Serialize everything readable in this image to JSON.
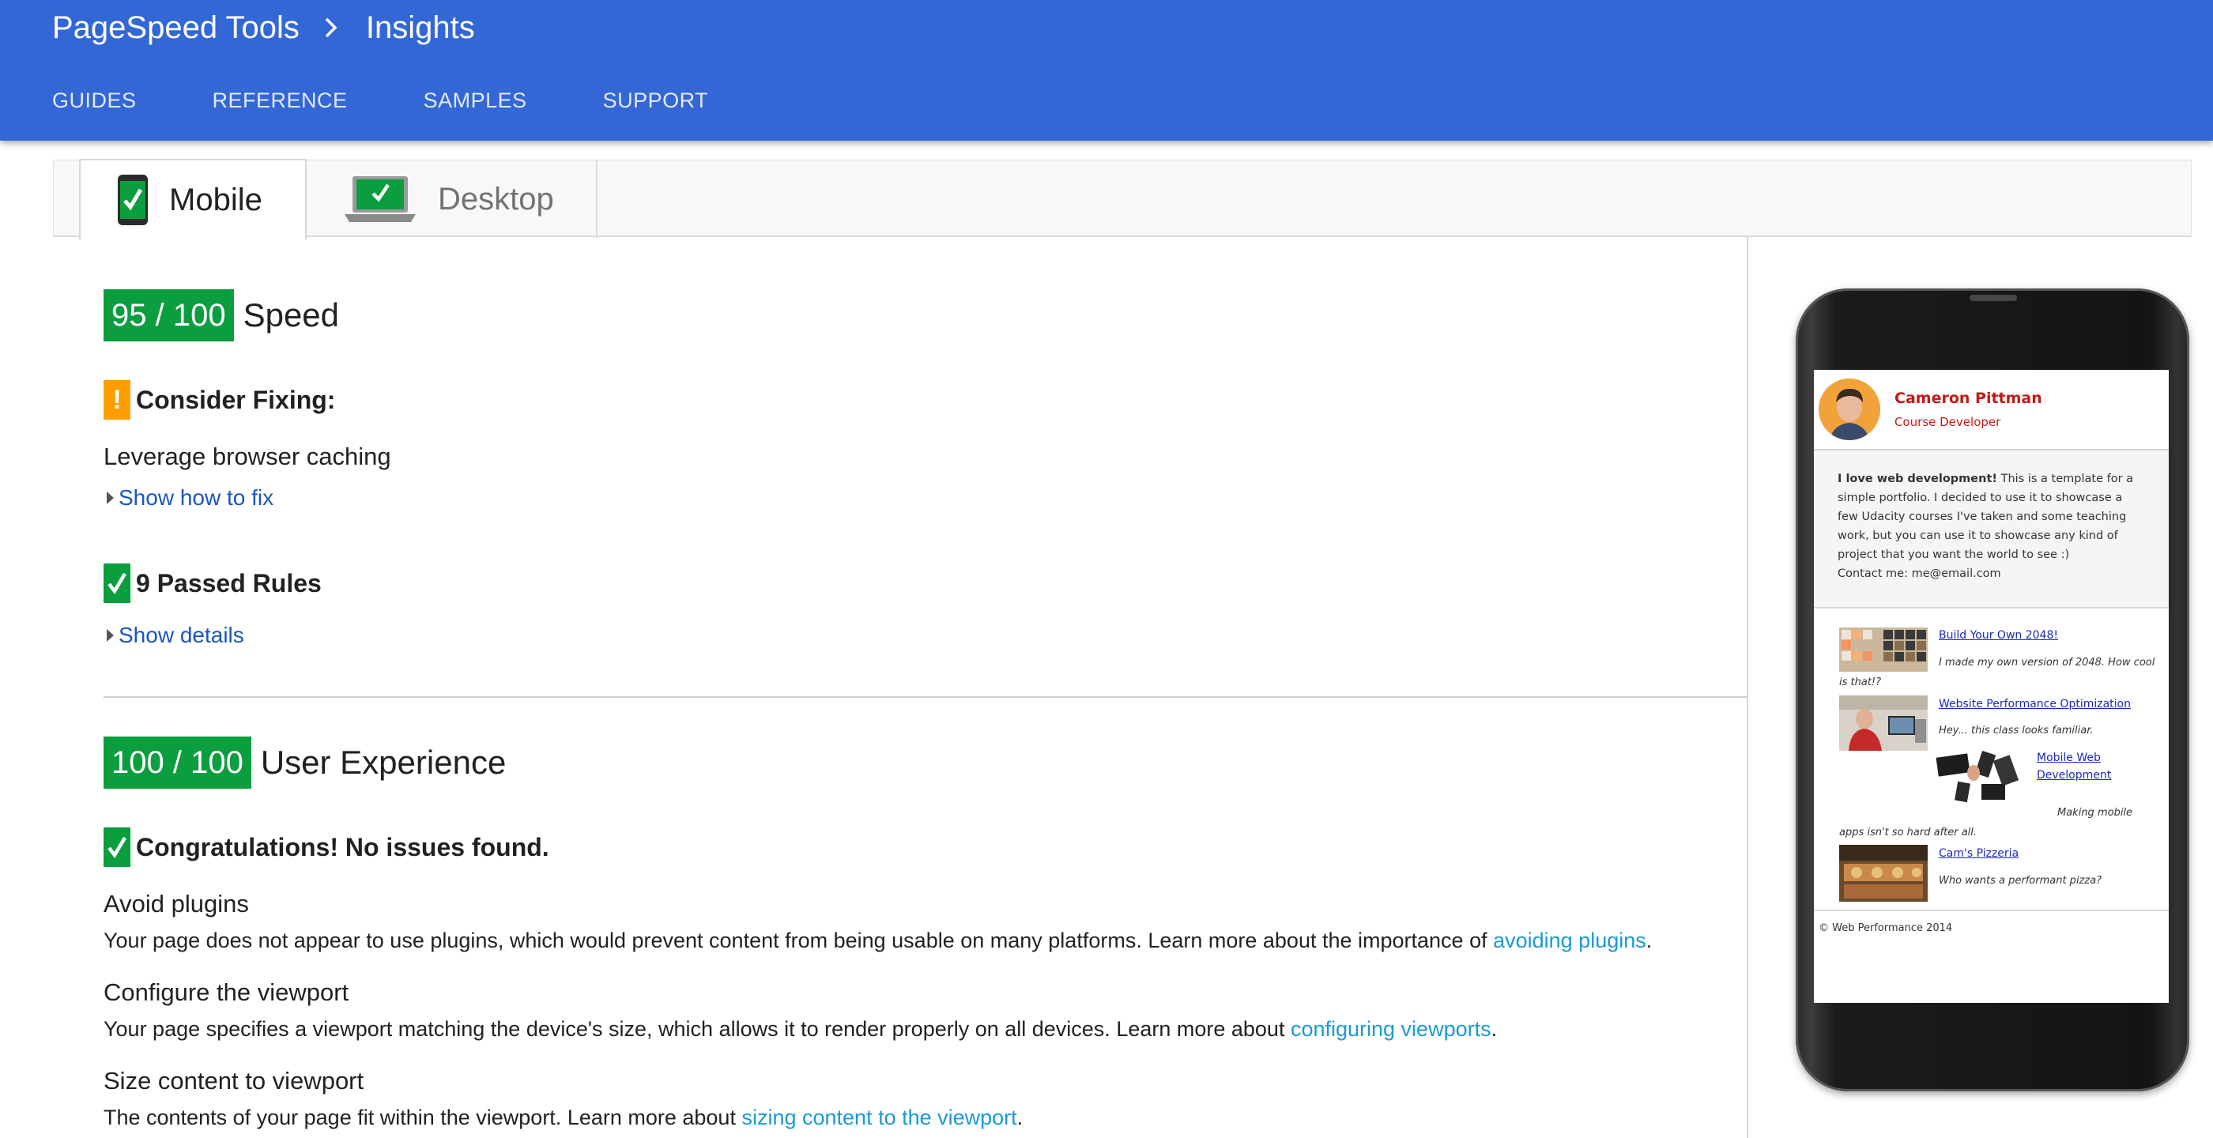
{
  "header": {
    "breadcrumb": [
      "PageSpeed Tools",
      "Insights"
    ],
    "nav": [
      "GUIDES",
      "REFERENCE",
      "SAMPLES",
      "SUPPORT"
    ],
    "background": "#3367d6"
  },
  "tabs": [
    {
      "label": "Mobile",
      "icon": "phone-check-icon",
      "selected": true
    },
    {
      "label": "Desktop",
      "icon": "laptop-check-icon",
      "selected": false
    }
  ],
  "speed": {
    "score": "95 / 100",
    "title": "Speed",
    "consider_label": "Consider Fixing:",
    "consider_item": "Leverage browser caching",
    "show_fix": "Show how to fix",
    "passed_label": "9 Passed Rules",
    "show_details": "Show details"
  },
  "ux": {
    "score": "100 / 100",
    "title": "User Experience",
    "congrats": "Congratulations! No issues found.",
    "rules": [
      {
        "title": "Avoid plugins",
        "text": "Your page does not appear to use plugins, which would prevent content from being usable on many platforms. Learn more about the importance of ",
        "link": "avoiding plugins",
        "end": "."
      },
      {
        "title": "Configure the viewport",
        "text": "Your page specifies a viewport matching the device's size, which allows it to render properly on all devices. Learn more about ",
        "link": "configuring viewports",
        "end": "."
      },
      {
        "title": "Size content to viewport",
        "text": "The contents of your page fit within the viewport. Learn more about ",
        "link": "sizing content to the viewport",
        "end": "."
      }
    ]
  },
  "preview": {
    "name": "Cameron Pittman",
    "role": "Course Developer",
    "bio_bold": "I love web development!",
    "bio_text": " This is a template for a simple portfolio. I decided to use it to showcase a few Udacity courses I've taken and some teaching work, but you can use it to showcase any kind of project that you want the world to see :)",
    "contact": "Contact me: me@email.com",
    "items": [
      {
        "link": "Build Your Own 2048!",
        "caption": "I made my own version of 2048. How cool is that!?"
      },
      {
        "link": "Website Performance Optimization",
        "caption": "Hey... this class looks familiar."
      },
      {
        "link": "Mobile Web Development",
        "caption": "Making mobile apps isn't so hard after all."
      },
      {
        "link": "Cam's Pizzeria",
        "caption": "Who wants a performant pizza?"
      }
    ],
    "footer": "© Web Performance 2014"
  },
  "colors": {
    "score_green": "#0a9e3f",
    "warning_orange": "#ff9d00",
    "link_blue": "#1a55c0",
    "learn_link": "#1a9ad6",
    "name_red": "#c01a1a"
  }
}
